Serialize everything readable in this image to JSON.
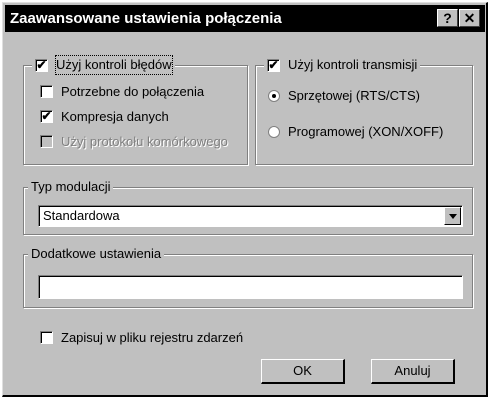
{
  "window": {
    "title": "Zaawansowane ustawienia połączenia",
    "help_button": "?",
    "close_button": "✕"
  },
  "error_control": {
    "label": "Użyj kontroli błędów",
    "checked": true,
    "options": [
      {
        "label": "Potrzebne do połączenia",
        "checked": false,
        "enabled": true
      },
      {
        "label": "Kompresja danych",
        "checked": true,
        "enabled": true
      },
      {
        "label": "Użyj protokołu komórkowego",
        "checked": false,
        "enabled": false
      }
    ]
  },
  "flow_control": {
    "label": "Użyj kontroli transmisji",
    "checked": true,
    "options": [
      {
        "label": "Sprzętowej (RTS/CTS)",
        "selected": true
      },
      {
        "label": "Programowej (XON/XOFF)",
        "selected": false
      }
    ]
  },
  "modulation": {
    "label": "Typ modulacji",
    "value": "Standardowa"
  },
  "extra_settings": {
    "label": "Dodatkowe ustawienia",
    "value": ""
  },
  "log": {
    "label": "Zapisuj w pliku rejestru zdarzeń",
    "checked": false
  },
  "buttons": {
    "ok": "OK",
    "cancel": "Anuluj"
  }
}
